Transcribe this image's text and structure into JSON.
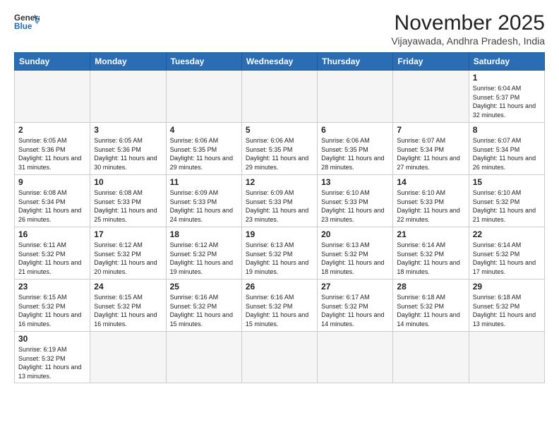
{
  "header": {
    "logo_general": "General",
    "logo_blue": "Blue",
    "month_title": "November 2025",
    "location": "Vijayawada, Andhra Pradesh, India"
  },
  "weekdays": [
    "Sunday",
    "Monday",
    "Tuesday",
    "Wednesday",
    "Thursday",
    "Friday",
    "Saturday"
  ],
  "days": [
    {
      "num": "",
      "empty": true
    },
    {
      "num": "",
      "empty": true
    },
    {
      "num": "",
      "empty": true
    },
    {
      "num": "",
      "empty": true
    },
    {
      "num": "",
      "empty": true
    },
    {
      "num": "",
      "empty": true
    },
    {
      "num": "1",
      "sunrise": "6:04 AM",
      "sunset": "5:37 PM",
      "daylight": "11 hours and 32 minutes."
    },
    {
      "num": "2",
      "sunrise": "6:05 AM",
      "sunset": "5:36 PM",
      "daylight": "11 hours and 31 minutes."
    },
    {
      "num": "3",
      "sunrise": "6:05 AM",
      "sunset": "5:36 PM",
      "daylight": "11 hours and 30 minutes."
    },
    {
      "num": "4",
      "sunrise": "6:06 AM",
      "sunset": "5:35 PM",
      "daylight": "11 hours and 29 minutes."
    },
    {
      "num": "5",
      "sunrise": "6:06 AM",
      "sunset": "5:35 PM",
      "daylight": "11 hours and 29 minutes."
    },
    {
      "num": "6",
      "sunrise": "6:06 AM",
      "sunset": "5:35 PM",
      "daylight": "11 hours and 28 minutes."
    },
    {
      "num": "7",
      "sunrise": "6:07 AM",
      "sunset": "5:34 PM",
      "daylight": "11 hours and 27 minutes."
    },
    {
      "num": "8",
      "sunrise": "6:07 AM",
      "sunset": "5:34 PM",
      "daylight": "11 hours and 26 minutes."
    },
    {
      "num": "9",
      "sunrise": "6:08 AM",
      "sunset": "5:34 PM",
      "daylight": "11 hours and 26 minutes."
    },
    {
      "num": "10",
      "sunrise": "6:08 AM",
      "sunset": "5:33 PM",
      "daylight": "11 hours and 25 minutes."
    },
    {
      "num": "11",
      "sunrise": "6:09 AM",
      "sunset": "5:33 PM",
      "daylight": "11 hours and 24 minutes."
    },
    {
      "num": "12",
      "sunrise": "6:09 AM",
      "sunset": "5:33 PM",
      "daylight": "11 hours and 23 minutes."
    },
    {
      "num": "13",
      "sunrise": "6:10 AM",
      "sunset": "5:33 PM",
      "daylight": "11 hours and 23 minutes."
    },
    {
      "num": "14",
      "sunrise": "6:10 AM",
      "sunset": "5:33 PM",
      "daylight": "11 hours and 22 minutes."
    },
    {
      "num": "15",
      "sunrise": "6:10 AM",
      "sunset": "5:32 PM",
      "daylight": "11 hours and 21 minutes."
    },
    {
      "num": "16",
      "sunrise": "6:11 AM",
      "sunset": "5:32 PM",
      "daylight": "11 hours and 21 minutes."
    },
    {
      "num": "17",
      "sunrise": "6:12 AM",
      "sunset": "5:32 PM",
      "daylight": "11 hours and 20 minutes."
    },
    {
      "num": "18",
      "sunrise": "6:12 AM",
      "sunset": "5:32 PM",
      "daylight": "11 hours and 19 minutes."
    },
    {
      "num": "19",
      "sunrise": "6:13 AM",
      "sunset": "5:32 PM",
      "daylight": "11 hours and 19 minutes."
    },
    {
      "num": "20",
      "sunrise": "6:13 AM",
      "sunset": "5:32 PM",
      "daylight": "11 hours and 18 minutes."
    },
    {
      "num": "21",
      "sunrise": "6:14 AM",
      "sunset": "5:32 PM",
      "daylight": "11 hours and 18 minutes."
    },
    {
      "num": "22",
      "sunrise": "6:14 AM",
      "sunset": "5:32 PM",
      "daylight": "11 hours and 17 minutes."
    },
    {
      "num": "23",
      "sunrise": "6:15 AM",
      "sunset": "5:32 PM",
      "daylight": "11 hours and 16 minutes."
    },
    {
      "num": "24",
      "sunrise": "6:15 AM",
      "sunset": "5:32 PM",
      "daylight": "11 hours and 16 minutes."
    },
    {
      "num": "25",
      "sunrise": "6:16 AM",
      "sunset": "5:32 PM",
      "daylight": "11 hours and 15 minutes."
    },
    {
      "num": "26",
      "sunrise": "6:16 AM",
      "sunset": "5:32 PM",
      "daylight": "11 hours and 15 minutes."
    },
    {
      "num": "27",
      "sunrise": "6:17 AM",
      "sunset": "5:32 PM",
      "daylight": "11 hours and 14 minutes."
    },
    {
      "num": "28",
      "sunrise": "6:18 AM",
      "sunset": "5:32 PM",
      "daylight": "11 hours and 14 minutes."
    },
    {
      "num": "29",
      "sunrise": "6:18 AM",
      "sunset": "5:32 PM",
      "daylight": "11 hours and 13 minutes."
    },
    {
      "num": "30",
      "sunrise": "6:19 AM",
      "sunset": "5:32 PM",
      "daylight": "11 hours and 13 minutes."
    },
    {
      "num": "",
      "empty": true
    },
    {
      "num": "",
      "empty": true
    },
    {
      "num": "",
      "empty": true
    },
    {
      "num": "",
      "empty": true
    },
    {
      "num": "",
      "empty": true
    },
    {
      "num": "",
      "empty": true
    }
  ]
}
